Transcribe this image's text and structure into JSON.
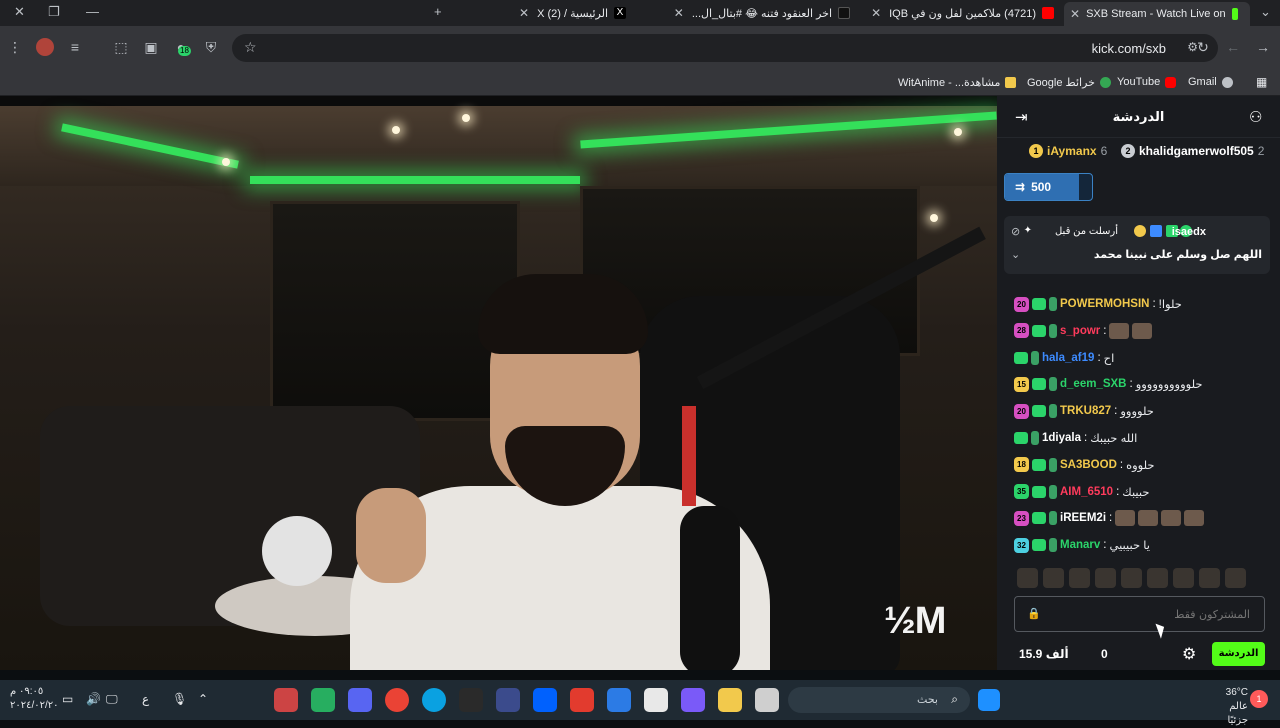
{
  "browser": {
    "tabs": [
      {
        "label": "SXB Stream - Watch Live on",
        "active": true
      },
      {
        "label": "(4721) ملاكمين لفل ون في IQB"
      },
      {
        "label": "اخر العنقود فتنه 😂 #بتال_ال..."
      },
      {
        "label": "الرئيسية / X (2)"
      }
    ],
    "new_tab": "+",
    "address": "kick.com/sxb",
    "extension_badge": "18",
    "bookmarks": [
      "Gmail",
      "YouTube",
      "خرائط Google",
      "مشاهدة... - WitAnime"
    ]
  },
  "video": {
    "watermark": "½M"
  },
  "chat": {
    "title": "الدردشة",
    "leaderboard": [
      {
        "rank": "2",
        "name": "khalidgamerwolf505",
        "count": "2"
      },
      {
        "rank": "1",
        "name": "iAymanx",
        "count": "6"
      }
    ],
    "goal": {
      "value": "500",
      "fill": 0.85
    },
    "pinned": {
      "user": "isaedx",
      "label": "أرسلت من قبل",
      "message": "اللهم صل وسلم على نبينا محمد"
    },
    "messages": [
      {
        "level": "20",
        "level_color": "#d64fc1",
        "user": "POWERMOHSIN",
        "user_color": "#f2c94c",
        "text": "حلوا!"
      },
      {
        "level": "28",
        "level_color": "#d64fc1",
        "user": "s_powr",
        "user_color": "#ff3b5c",
        "text": ""
      },
      {
        "level": "",
        "level_color": "",
        "user": "hala_af19",
        "user_color": "#3d8bff",
        "text": "اح"
      },
      {
        "level": "15",
        "level_color": "#f2c94c",
        "user": "d_eem_SXB",
        "user_color": "#2bd46a",
        "text": "حلوووووووووو"
      },
      {
        "level": "20",
        "level_color": "#d64fc1",
        "user": "TRKU827",
        "user_color": "#f2c94c",
        "text": "حلوووو"
      },
      {
        "level": "",
        "level_color": "",
        "user": "1diyala",
        "user_color": "#ffffff",
        "text": "الله حبيبك"
      },
      {
        "level": "18",
        "level_color": "#f2c94c",
        "user": "SA3BOOD",
        "user_color": "#f2c94c",
        "text": "حلووه"
      },
      {
        "level": "35",
        "level_color": "#2bd46a",
        "user": "AIM_6510",
        "user_color": "#ff3b5c",
        "text": "حبيبك"
      },
      {
        "level": "23",
        "level_color": "#d64fc1",
        "user": "iREEM2i",
        "user_color": "#ffffff",
        "text": ""
      },
      {
        "level": "32",
        "level_color": "#4dd0e1",
        "user": "Manarv",
        "user_color": "#2bd46a",
        "text": "يا حبيبيي"
      }
    ],
    "input_placeholder": "المشتركون فقط",
    "send_label": "الدردشة",
    "viewers": "15.9 ألف",
    "points": "0"
  },
  "taskbar": {
    "search_placeholder": "بحث",
    "time": "٠٩:٠٥ م",
    "date": "٢٠٢٤/٠٢/٢٠",
    "lang": "ع",
    "weather_temp": "36°C",
    "weather_desc": "عالم جزئيًا",
    "notif_count": "1"
  },
  "colors": {
    "kick_green": "#53fc18",
    "accent_blue": "#3d8bff"
  }
}
